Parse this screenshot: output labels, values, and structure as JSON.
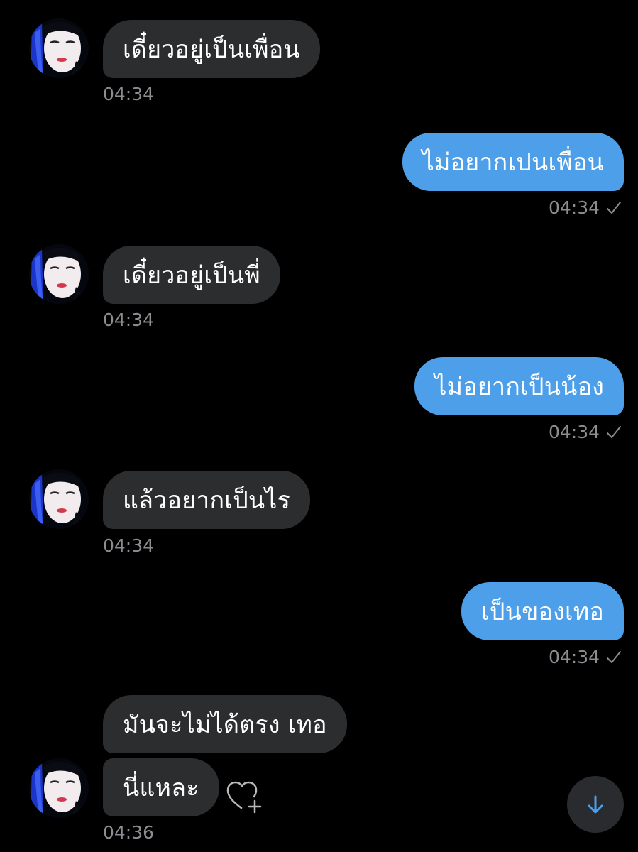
{
  "colors": {
    "background": "#000000",
    "incoming_bubble": "#2c2d2f",
    "outgoing_bubble": "#4c9fe8",
    "timestamp": "#8b8d92",
    "accent": "#4c9fe8"
  },
  "messages": [
    {
      "direction": "incoming",
      "text": "เดี๋ยวอยู่เป็นเพื่อน",
      "time": "04:34"
    },
    {
      "direction": "outgoing",
      "text": "ไม่อยากเปนเพื่อน",
      "time": "04:34",
      "status_icon": "checkmark-icon"
    },
    {
      "direction": "incoming",
      "text": "เดี๋ยวอยู่เป็นพี่",
      "time": "04:34"
    },
    {
      "direction": "outgoing",
      "text": "ไม่อยากเป็นน้อง",
      "time": "04:34",
      "status_icon": "checkmark-icon"
    },
    {
      "direction": "incoming",
      "text": "แล้วอยากเป็นไร",
      "time": "04:34"
    },
    {
      "direction": "outgoing",
      "text": "เป็นของเทอ",
      "time": "04:34",
      "status_icon": "checkmark-icon"
    },
    {
      "direction": "incoming",
      "text": "มันจะไม่ได้ตรง เทอ"
    },
    {
      "direction": "incoming",
      "text": "นี่แหละ",
      "time": "04:36"
    }
  ],
  "controls": {
    "react_icon": "heart-plus-icon",
    "scroll_icon": "arrow-down-icon"
  }
}
